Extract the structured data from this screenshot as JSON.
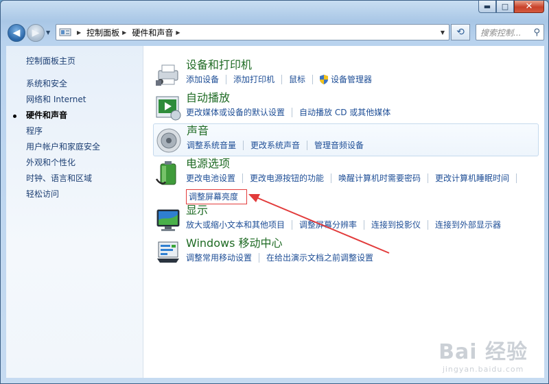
{
  "window": {
    "caption_buttons": {
      "minimize": "▬",
      "maximize": "□",
      "close": "✕"
    }
  },
  "navbar": {
    "back_icon": "back-arrow-icon",
    "forward_icon": "forward-arrow-icon",
    "breadcrumbs": [
      "控制面板",
      "硬件和声音"
    ],
    "search_placeholder": "搜索控制...",
    "refresh_icon": "refresh-icon",
    "search_icon": "magnifier-icon"
  },
  "sidebar": {
    "home": "控制面板主页",
    "items": [
      {
        "label": "系统和安全",
        "current": false
      },
      {
        "label": "网络和 Internet",
        "current": false
      },
      {
        "label": "硬件和声音",
        "current": true
      },
      {
        "label": "程序",
        "current": false
      },
      {
        "label": "用户帐户和家庭安全",
        "current": false
      },
      {
        "label": "外观和个性化",
        "current": false
      },
      {
        "label": "时钟、语言和区域",
        "current": false
      },
      {
        "label": "轻松访问",
        "current": false
      }
    ]
  },
  "categories": [
    {
      "title": "设备和打印机",
      "icon": "printer-icon",
      "links": [
        "添加设备",
        "添加打印机",
        "鼠标",
        "设备管理器"
      ]
    },
    {
      "title": "自动播放",
      "icon": "autoplay-icon",
      "links": [
        "更改媒体或设备的默认设置",
        "自动播放 CD 或其他媒体"
      ]
    },
    {
      "title": "声音",
      "icon": "speaker-icon",
      "links": [
        "调整系统音量",
        "更改系统声音",
        "管理音频设备"
      ]
    },
    {
      "title": "电源选项",
      "icon": "battery-icon",
      "links": [
        "更改电池设置",
        "更改电源按钮的功能",
        "唤醒计算机时需要密码",
        "更改计算机睡眠时间"
      ],
      "extra_link": "调整屏幕亮度"
    },
    {
      "title": "显示",
      "icon": "monitor-icon",
      "links": [
        "放大或缩小文本和其他项目",
        "调整屏幕分辨率",
        "连接到投影仪",
        "连接到外部显示器"
      ]
    },
    {
      "title": "Windows 移动中心",
      "icon": "mobility-center-icon",
      "links": [
        "调整常用移动设置",
        "在给出演示文档之前调整设置"
      ]
    }
  ],
  "colors": {
    "link": "#1e4e96",
    "category_title": "#1e6a23",
    "annotation": "#e23b3b"
  },
  "watermark": {
    "logo": "Bai 经验",
    "url": "jingyan.baidu.com"
  }
}
